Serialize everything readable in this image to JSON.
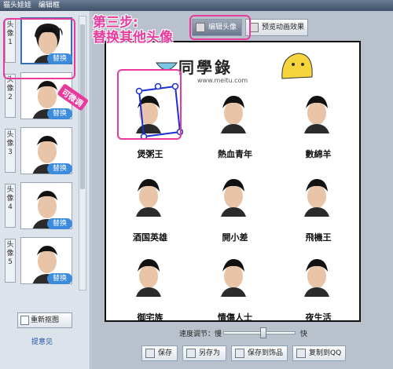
{
  "window": {
    "title_app": "猫头娃娃",
    "title_mode": "编辑框"
  },
  "left_panel": {
    "slots": [
      {
        "label": "头像1",
        "replace_label": "替换",
        "active": true
      },
      {
        "label": "头像2",
        "replace_label": "替换",
        "active": false
      },
      {
        "label": "头像3",
        "replace_label": "替换",
        "active": false
      },
      {
        "label": "头像4",
        "replace_label": "替换",
        "active": false
      },
      {
        "label": "头像5",
        "replace_label": "替换",
        "active": false
      }
    ],
    "reselect_label": "重新抠图",
    "feedback_label": "提意见"
  },
  "tabs": {
    "edit_avatar": "编辑头像",
    "preview_animation": "预览动画效果"
  },
  "canvas": {
    "logo_text": "同學錄",
    "logo_url": "www.meitu.com",
    "cells": [
      {
        "caption": "煲粥王"
      },
      {
        "caption": "熱血青年"
      },
      {
        "caption": "數綿羊"
      },
      {
        "caption": "酒国英雄"
      },
      {
        "caption": "開小差"
      },
      {
        "caption": "飛機王"
      },
      {
        "caption": "御宅族"
      },
      {
        "caption": "情傷人士"
      },
      {
        "caption": "夜生活"
      }
    ]
  },
  "controls": {
    "speed_label": "速度调节：慢",
    "speed_fast": "快",
    "speed_value_percent": 55,
    "save": "保存",
    "save_as": "另存为",
    "save_to_accessory": "保存到饰品",
    "copy_to_qq": "复制到QQ"
  },
  "annotations": {
    "step_line1": "第三步:",
    "step_line2": "替换其他头像",
    "tag": "可微调"
  },
  "colors": {
    "annotation": "#e83a9d",
    "replace_button": "#3d8bdc",
    "link": "#1d4fa8"
  }
}
